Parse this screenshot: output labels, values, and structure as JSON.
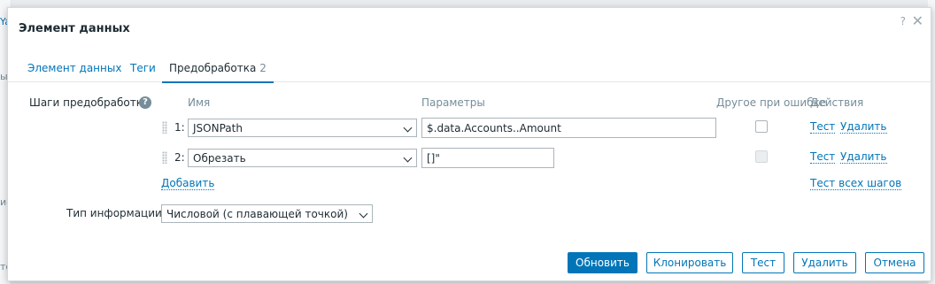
{
  "background": {
    "frag_top": "Ya",
    "frag_mid1": "ы",
    "frag_mid2": "ие",
    "frag_bot": "тс"
  },
  "dialog": {
    "title": "Элемент данных",
    "help": "?",
    "close": "✕"
  },
  "tabs": [
    {
      "label": "Элемент данных"
    },
    {
      "label": "Теги"
    },
    {
      "label": "Предобработка",
      "badge": "2",
      "active": true
    }
  ],
  "preprocessing": {
    "label": "Шаги предобработки",
    "help_icon": "?",
    "headers": {
      "name": "Имя",
      "params": "Параметры",
      "custom_on_fail": "Другое при ошибке",
      "actions": "Действия"
    },
    "steps": [
      {
        "num": "1:",
        "type": "JSONPath",
        "param": "$.data.Accounts..Amount",
        "custom_on_fail": false,
        "custom_disabled": false,
        "test": "Тест",
        "remove": "Удалить"
      },
      {
        "num": "2:",
        "type": "Обрезать",
        "param": "[]\"",
        "custom_on_fail": false,
        "custom_disabled": true,
        "test": "Тест",
        "remove": "Удалить"
      }
    ],
    "add": "Добавить",
    "test_all": "Тест всех шагов"
  },
  "info_type": {
    "label": "Тип информации",
    "value": "Числовой (с плавающей точкой)"
  },
  "buttons": {
    "update": "Обновить",
    "clone": "Клонировать",
    "test": "Тест",
    "delete": "Удалить",
    "cancel": "Отмена"
  },
  "colors": {
    "accent": "#0275b8",
    "text": "#1f2c33",
    "muted": "#768d99"
  }
}
